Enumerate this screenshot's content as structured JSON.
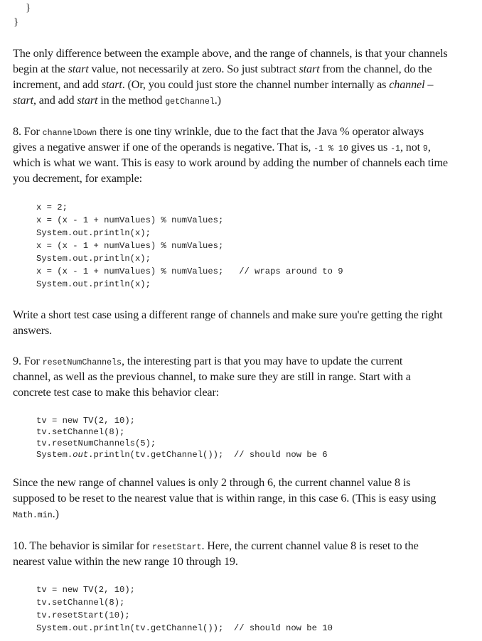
{
  "top_code": {
    "inner_brace": "}",
    "outer_brace": "}"
  },
  "para1": {
    "l1": "The only difference between the example above, and the range of channels, is that your channels",
    "l2_a": "begin at the ",
    "l2_i": "start",
    "l2_b": " value, not necessarily at zero.  So just subtract ",
    "l2_i2": "start",
    "l2_c": " from the channel, do the",
    "l3_a": "increment, and add ",
    "l3_i": "start",
    "l3_b": ".  (Or, you could just store the channel number internally as ",
    "l3_i2": "channel",
    "l3_c": " –",
    "l4_i": "start",
    "l4_a": ", and add ",
    "l4_i2": "start",
    "l4_b": " in the method ",
    "l4_code": "getChannel",
    "l4_c": ".)"
  },
  "item8": {
    "l1_a": "8. For ",
    "l1_code": "channelDown",
    "l1_b": " there is one tiny wrinkle, due to the fact that the Java % operator always",
    "l2_a": "gives a negative answer if one of the operands is negative.  That is, ",
    "l2_code1": "-1 % 10",
    "l2_b": " gives us ",
    "l2_code2": "-1",
    "l2_c": ", not ",
    "l2_code3": "9",
    "l2_d": ",",
    "l3": "which is what we want. This is easy to work around by adding the number of channels each time",
    "l4": "you decrement, for example:",
    "code": [
      "x = 2;",
      "x = (x - 1 + numValues) % numValues;",
      "System.out.println(x);",
      "x = (x - 1 + numValues) % numValues;",
      "System.out.println(x);",
      "x = (x - 1 + numValues) % numValues;   // wraps around to 9",
      "System.out.println(x);"
    ]
  },
  "test_para": {
    "l1": "Write a short test case using a different range of channels and make sure you're getting the right",
    "l2": "answers."
  },
  "item9": {
    "l1_a": "9.  For ",
    "l1_code": "resetNumChannels",
    "l1_b": ", the interesting part is that you may have to update the current",
    "l2": "channel, as well as the previous channel, to make sure they are still in range.  Start with a",
    "l3": "concrete test case to make this behavior clear:",
    "code": [
      "tv = new TV(2, 10);",
      "tv.setChannel(8);",
      "tv.resetNumChannels(5);"
    ],
    "code_last_a": "System.",
    "code_last_i": "out",
    "code_last_b": ".println(tv.getChannel());  // should now be 6"
  },
  "since_para": {
    "l1": "Since the new range of channel values is only 2 through 6, the current channel value 8 is",
    "l2": "supposed to be reset to the nearest value that is within range, in this case 6.  (This is easy using",
    "l3_code": "Math.min",
    "l3_b": ".)"
  },
  "item10": {
    "l1_a": "10.  The behavior is similar for ",
    "l1_code": "resetStart",
    "l1_b": ". Here, the current channel value 8 is reset to the",
    "l2": "nearest value within the new range 10 through 19.",
    "code": [
      "tv = new TV(2, 10);",
      "tv.setChannel(8);",
      "tv.resetStart(10);",
      "System.out.println(tv.getChannel());  // should now be 10"
    ]
  }
}
